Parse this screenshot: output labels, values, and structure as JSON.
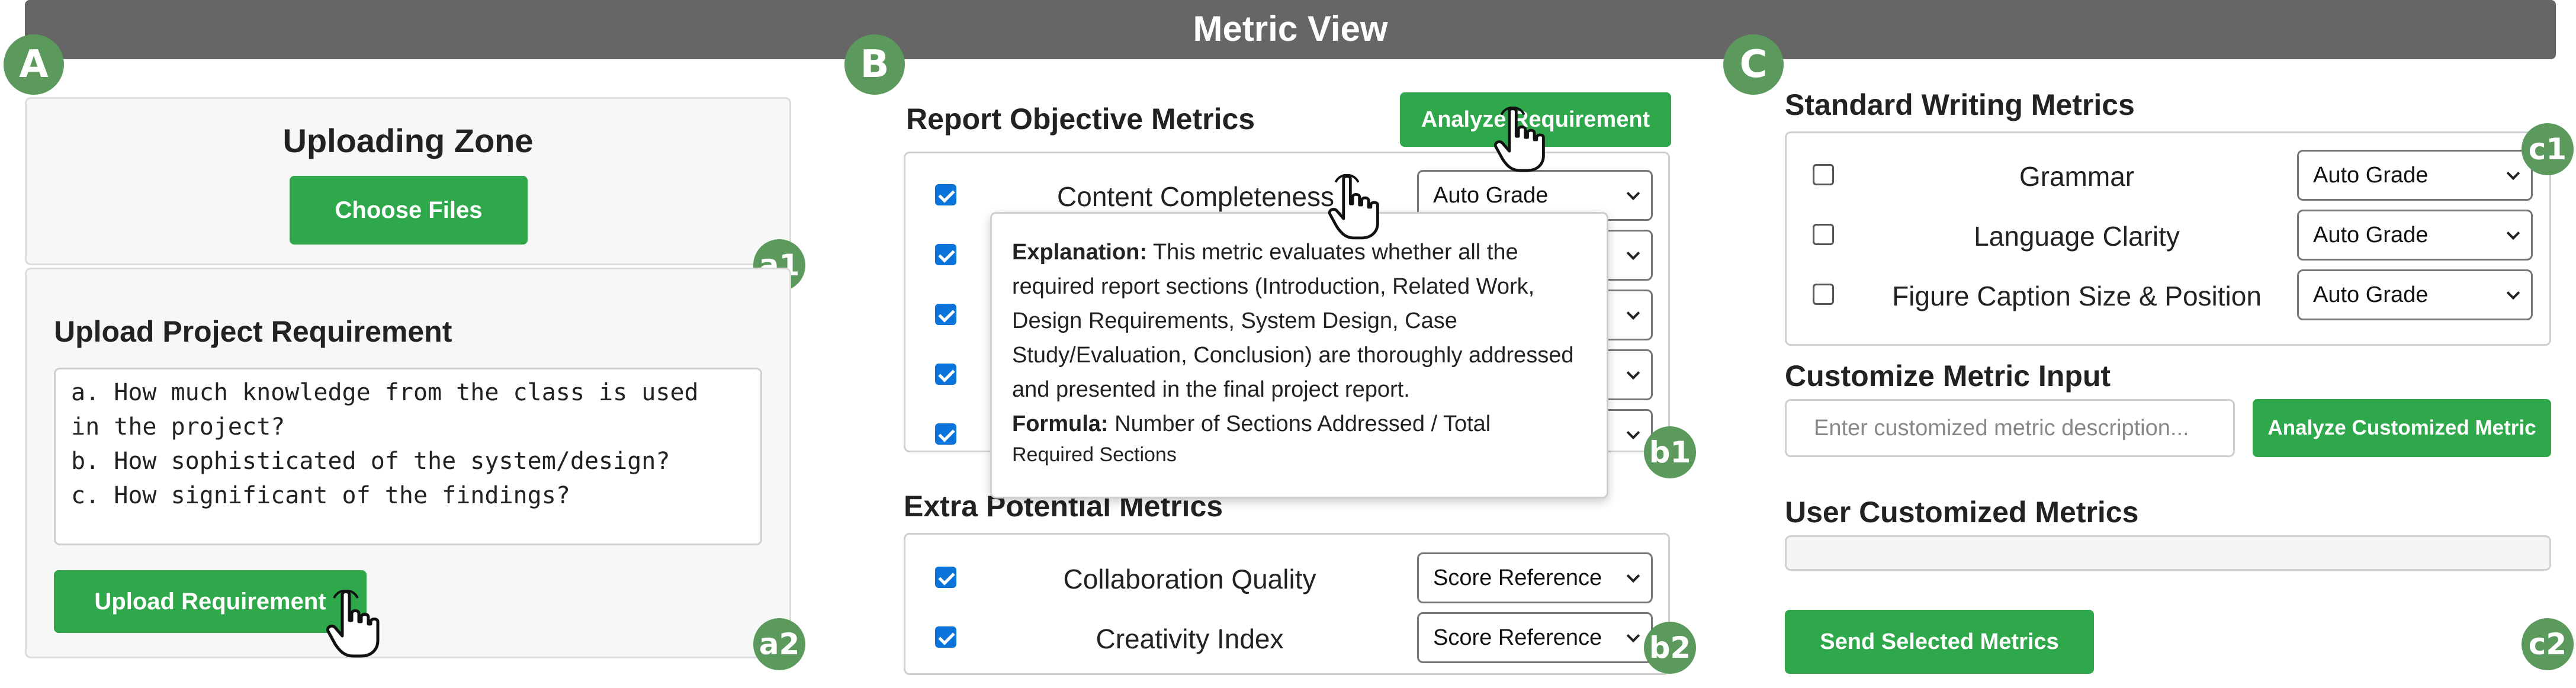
{
  "title": "Metric View",
  "section_markers": {
    "a": "A",
    "b": "B",
    "c": "C"
  },
  "sub_markers": {
    "a1": "a1",
    "a2": "a2",
    "b1": "b1",
    "b2": "b2",
    "c1": "c1",
    "c2": "c2"
  },
  "upload_zone": {
    "title": "Uploading Zone",
    "choose_files": "Choose Files"
  },
  "project_req": {
    "title": "Upload Project Requirement",
    "text": "a. How much knowledge from the class is used\nin the project?\nb. How sophisticated of the system/design?\nc. How significant of the findings?",
    "upload_button": "Upload Requirement"
  },
  "report_objective": {
    "title": "Report Objective Metrics",
    "analyze_button": "Analyze Requirement",
    "metrics": [
      {
        "label": "Content Completeness",
        "checked": true,
        "grade": "Auto Grade"
      },
      {
        "label": "",
        "checked": true,
        "grade": ""
      },
      {
        "label": "",
        "checked": true,
        "grade": ""
      },
      {
        "label": "",
        "checked": true,
        "grade": ""
      },
      {
        "label": "",
        "checked": true,
        "grade": ""
      }
    ]
  },
  "tooltip": {
    "explanation_label": "Explanation:",
    "explanation_text": " This metric evaluates whether all the required report sections (Introduction, Related Work, Design Requirements, System Design, Case Study/Evaluation, Conclusion) are thoroughly addressed and presented in the final project report.",
    "formula_label": "Formula:",
    "formula_text": " Number of Sections Addressed / Total",
    "formula_text_2": "Required Sections"
  },
  "extra_metrics": {
    "title": "Extra Potential Metrics",
    "metrics": [
      {
        "label": "Collaboration Quality",
        "checked": true,
        "grade": "Score Reference"
      },
      {
        "label": "Creativity Index",
        "checked": true,
        "grade": "Score Reference"
      }
    ]
  },
  "standard_writing": {
    "title": "Standard Writing Metrics",
    "metrics": [
      {
        "label": "Grammar",
        "checked": false,
        "grade": "Auto Grade"
      },
      {
        "label": "Language Clarity",
        "checked": false,
        "grade": "Auto Grade"
      },
      {
        "label": "Figure Caption Size & Position",
        "checked": false,
        "grade": "Auto Grade"
      }
    ]
  },
  "customize": {
    "title": "Customize Metric Input",
    "placeholder": "Enter customized metric description...",
    "analyze_button": "Analyze Customized Metric"
  },
  "user_custom": {
    "title": "User Customized Metrics"
  },
  "send_button": "Send Selected Metrics",
  "colors": {
    "accent_green": "#2ea84a",
    "marker_green": "#5b9a5c",
    "title_bar": "#666666",
    "checkbox_blue": "#0a74da"
  }
}
